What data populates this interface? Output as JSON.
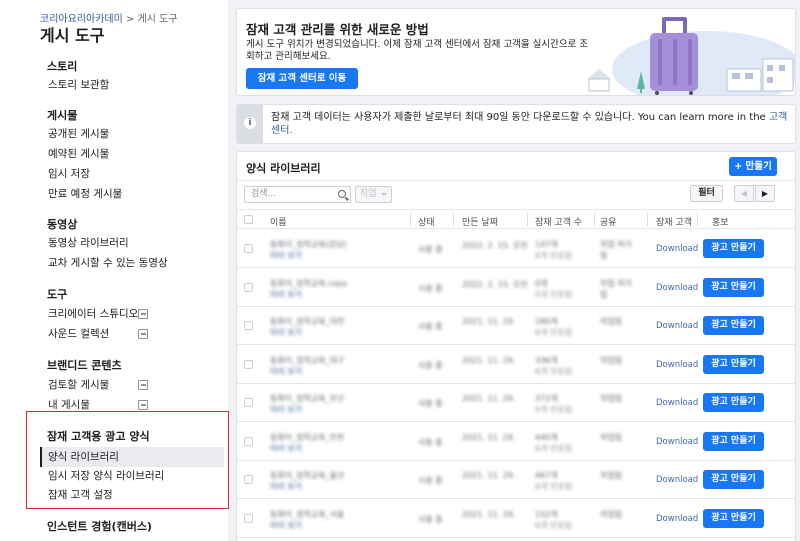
{
  "breadcrumb": {
    "parent": "코리아요리아카데미",
    "separator": ">",
    "current": "게시 도구"
  },
  "page_title": "게시 도구",
  "sidebar": {
    "sections": [
      {
        "title": "스토리",
        "items": [
          {
            "label": "스토리 보관함",
            "external": false
          }
        ]
      },
      {
        "title": "게시물",
        "items": [
          {
            "label": "공개된 게시물",
            "external": false
          },
          {
            "label": "예약된 게시물",
            "external": false
          },
          {
            "label": "임시 저장",
            "external": false
          },
          {
            "label": "만료 예정 게시물",
            "external": false
          }
        ]
      },
      {
        "title": "동영상",
        "items": [
          {
            "label": "동영상 라이브러리",
            "external": false
          },
          {
            "label": "교차 게시할 수 있는 동영상",
            "external": false
          }
        ]
      },
      {
        "title": "도구",
        "items": [
          {
            "label": "크리에이터 스튜디오",
            "external": true
          },
          {
            "label": "사운드 컬렉션",
            "external": true
          }
        ]
      },
      {
        "title": "브랜디드 콘텐츠",
        "items": [
          {
            "label": "검토할 게시물",
            "external": true
          },
          {
            "label": "내 게시물",
            "external": true
          }
        ]
      },
      {
        "title": "잠재 고객용 광고 양식",
        "items": [
          {
            "label": "양식 라이브러리",
            "active": true
          },
          {
            "label": "임시 저장 양식 라이브러리"
          },
          {
            "label": "잠재 고객 설정"
          }
        ]
      },
      {
        "title": "인스턴트 경험(캔버스)",
        "items": []
      }
    ]
  },
  "banner": {
    "title": "잠재 고객 관리를 위한 새로운 방법",
    "body": "게시 도구 위치가 변경되었습니다. 이제 잠재 고객 센터에서 잠재 고객을 실시간으로 조회하고 관리해보세요.",
    "button": "잠재 고객 센터로 이동",
    "illustration_colors": {
      "suitcase": "#a58fd8",
      "sky": "#dfe9f7",
      "tree": "#5cb8a5"
    }
  },
  "notice": {
    "icon": "info-icon",
    "text": "잠재 고객 데이터는 사용자가 제출한 날로부터 최대 90일 동안 다운로드할 수 있습니다. You can learn more in the ",
    "link": "고객 센터."
  },
  "library": {
    "title": "양식 라이브러리",
    "create_button": "+ 만들기",
    "search_placeholder": "검색...",
    "action_dropdown": "작업",
    "filter_button": "필터",
    "prev_glyph": "◀",
    "next_glyph": "▶",
    "columns": [
      "이름",
      "상태",
      "만든 날짜",
      "잠재 고객 수",
      "공유",
      "잠재 고객",
      "홍보"
    ],
    "rows": [
      {
        "name": "동화이_정착교육(강남)",
        "link": "미리 보기",
        "status": "사용 중",
        "date": "2022. 2. 15. 오전",
        "count": "147개",
        "count_sub": "6개 만료됨",
        "share": "작업 허가",
        "share2": "됨",
        "download": "Download",
        "cta": "광고 만들기"
      },
      {
        "name": "동화이_정착교육.copy",
        "link": "미리 보기",
        "status": "사용 중",
        "date": "2022. 2. 15. 오전",
        "count": "0개",
        "count_sub": "0개 만료됨",
        "share": "작업 허가",
        "share2": "됨",
        "download": "Download",
        "cta": "광고 만들기"
      },
      {
        "name": "동화이_정착교육_대전",
        "link": "미리 보기",
        "status": "사용 중",
        "date": "2021. 11. 29.",
        "count": "280개",
        "count_sub": "6개 만료됨",
        "share": "작업됨",
        "share2": "",
        "download": "Download",
        "cta": "광고 만들기"
      },
      {
        "name": "동화이_정착교육_대구",
        "link": "미리 보기",
        "status": "사용 중",
        "date": "2021. 11. 29.",
        "count": "336개",
        "count_sub": "6개 만료됨",
        "share": "작업됨",
        "share2": "",
        "download": "Download",
        "cta": "광고 만들기"
      },
      {
        "name": "동화이_정착교육_부산",
        "link": "미리 보기",
        "status": "사용 중",
        "date": "2021. 11. 29.",
        "count": "372개",
        "count_sub": "6개 만료됨",
        "share": "작업됨",
        "share2": "",
        "download": "Download",
        "cta": "광고 만들기"
      },
      {
        "name": "동화이_정착교육_인천",
        "link": "미리 보기",
        "status": "사용 중",
        "date": "2021. 11. 29.",
        "count": "440개",
        "count_sub": "6개 만료됨",
        "share": "작업됨",
        "share2": "",
        "download": "Download",
        "cta": "광고 만들기"
      },
      {
        "name": "동화이_정착교육_울산",
        "link": "미리 보기",
        "status": "사용 중",
        "date": "2021. 11. 29.",
        "count": "467개",
        "count_sub": "6개 만료됨",
        "share": "작업됨",
        "share2": "",
        "download": "Download",
        "cta": "광고 만들기"
      },
      {
        "name": "동화이_정착교육_서울",
        "link": "미리 보기",
        "status": "사용 중",
        "date": "2021. 11. 29.",
        "count": "152개",
        "count_sub": "6개 만료됨",
        "share": "작업됨",
        "share2": "",
        "download": "Download",
        "cta": "광고 만들기"
      }
    ]
  },
  "accent_colors": {
    "primary": "#1877f2",
    "highlight": "#e0242b",
    "link": "#385898"
  }
}
